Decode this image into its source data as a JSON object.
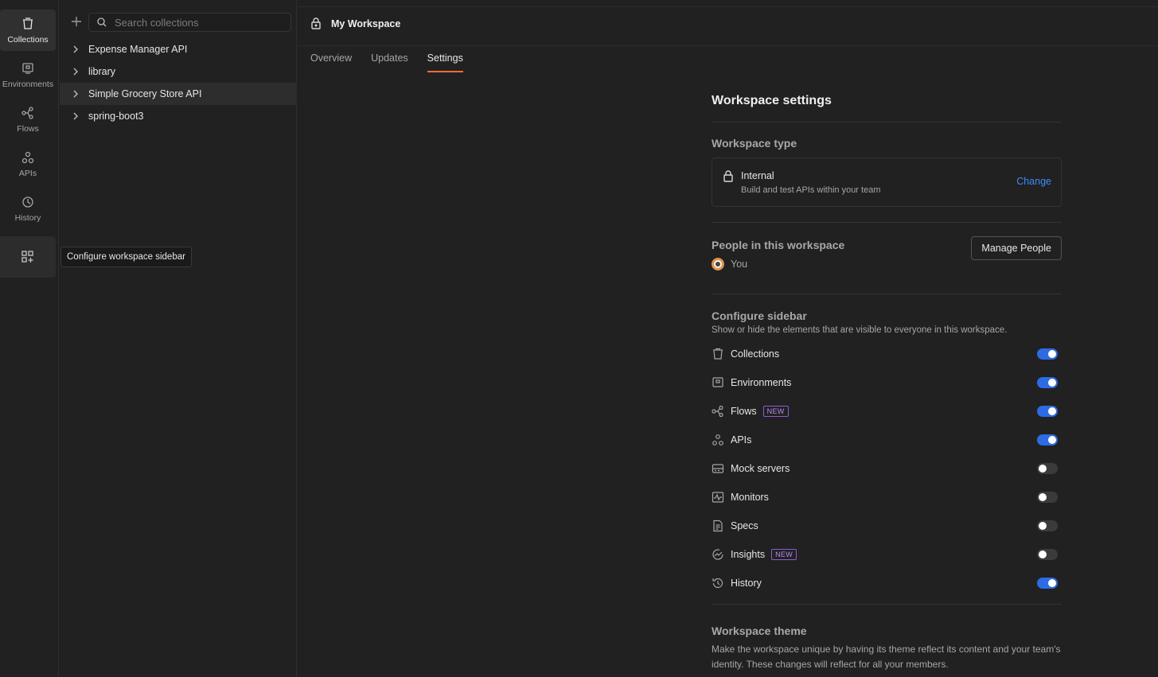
{
  "rail": {
    "items": [
      {
        "label": "Collections",
        "icon": "collections-icon"
      },
      {
        "label": "Environments",
        "icon": "environments-icon"
      },
      {
        "label": "Flows",
        "icon": "flows-icon"
      },
      {
        "label": "APIs",
        "icon": "apis-icon"
      },
      {
        "label": "History",
        "icon": "history-icon"
      }
    ],
    "configure_tooltip": "Configure workspace sidebar"
  },
  "collections": {
    "search_placeholder": "Search collections",
    "items": [
      {
        "label": "Expense Manager API"
      },
      {
        "label": "library"
      },
      {
        "label": "Simple Grocery Store API"
      },
      {
        "label": "spring-boot3"
      }
    ]
  },
  "header": {
    "title": "My Workspace",
    "tabs": [
      {
        "label": "Overview",
        "active": false
      },
      {
        "label": "Updates",
        "active": false
      },
      {
        "label": "Settings",
        "active": true
      }
    ]
  },
  "settings": {
    "title": "Workspace settings",
    "workspace_type": {
      "heading": "Workspace type",
      "name": "Internal",
      "description": "Build and test APIs within your team",
      "change_label": "Change"
    },
    "people": {
      "heading": "People in this workspace",
      "member": "You",
      "manage_label": "Manage People"
    },
    "sidebar": {
      "heading": "Configure sidebar",
      "description": "Show or hide the elements that are visible to everyone in this workspace.",
      "items": [
        {
          "label": "Collections",
          "icon": "collections-icon",
          "enabled": true,
          "badge": ""
        },
        {
          "label": "Environments",
          "icon": "environments-icon",
          "enabled": true,
          "badge": ""
        },
        {
          "label": "Flows",
          "icon": "flows-icon",
          "enabled": true,
          "badge": "NEW"
        },
        {
          "label": "APIs",
          "icon": "apis-icon",
          "enabled": true,
          "badge": ""
        },
        {
          "label": "Mock servers",
          "icon": "mock-servers-icon",
          "enabled": false,
          "badge": ""
        },
        {
          "label": "Monitors",
          "icon": "monitors-icon",
          "enabled": false,
          "badge": ""
        },
        {
          "label": "Specs",
          "icon": "specs-icon",
          "enabled": false,
          "badge": ""
        },
        {
          "label": "Insights",
          "icon": "insights-icon",
          "enabled": false,
          "badge": "NEW"
        },
        {
          "label": "History",
          "icon": "history-icon",
          "enabled": true,
          "badge": ""
        }
      ]
    },
    "theme": {
      "heading": "Workspace theme",
      "description": "Make the workspace unique by having its theme reflect its content and your team's identity. These changes will reflect for all your members."
    }
  },
  "colors": {
    "accent_orange": "#ff6c37",
    "toggle_on": "#2d6be4",
    "link_blue": "#3d8bfd",
    "badge_purple": "#b48cf2"
  }
}
